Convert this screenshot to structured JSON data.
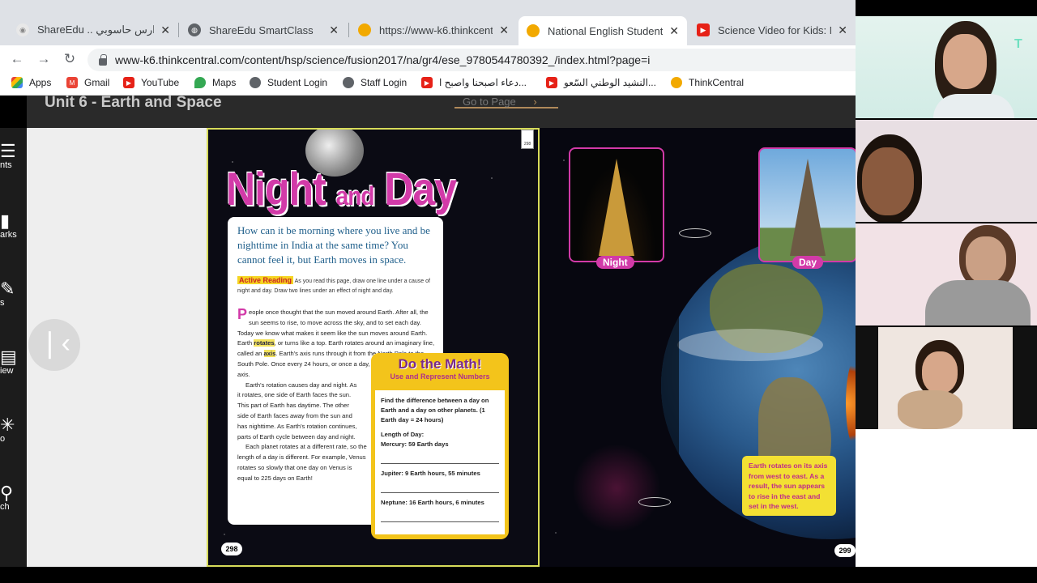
{
  "tabs": [
    {
      "title": "ShareEdu .. مدارس حاسوبي",
      "icon": "shareedu-icon",
      "active": false
    },
    {
      "title": "ShareEdu SmartClass",
      "icon": "globe-icon",
      "active": false
    },
    {
      "title": "https://www-k6.thinkcentra",
      "icon": "thinkcentral-icon",
      "active": false
    },
    {
      "title": "National English Student E",
      "icon": "thinkcentral-icon",
      "active": true
    },
    {
      "title": "Science Video for Kids: Nat",
      "icon": "youtube-icon",
      "active": false
    }
  ],
  "address_url": "www-k6.thinkcentral.com/content/hsp/science/fusion2017/na/gr4/ese_9780544780392_/index.html?page=i",
  "bookmarks": [
    {
      "label": "Apps"
    },
    {
      "label": "Gmail"
    },
    {
      "label": "YouTube"
    },
    {
      "label": "Maps"
    },
    {
      "label": "Student Login"
    },
    {
      "label": "Staff Login"
    },
    {
      "label": "دعاء اصبحنا واصبح ا..."
    },
    {
      "label": "النشيد الوطني السّعو..."
    },
    {
      "label": "ThinkCentral"
    }
  ],
  "viewer": {
    "unit_title": "Unit 6 - Earth and Space",
    "goto_label": "Go to Page",
    "left_nav": [
      "nts",
      "arks",
      "s",
      "iew",
      "o",
      "ch"
    ]
  },
  "left_page": {
    "title_night": "Night",
    "title_and": "and",
    "title_day": "Day",
    "question": "How can it be morning where you live and be nighttime in India at the same time? You cannot feel it, but Earth moves in space.",
    "active_reading_tag": "Active Reading",
    "active_reading_text": "As you read this page, draw one line under a cause of night and day. Draw two lines under an effect of night and day.",
    "drop_cap": "P",
    "p1_a": "eople once thought that the sun moved around Earth. After all, the sun seems to rise, to move across the sky, and to set each day. Today we know what makes it seem like the sun moves around Earth. Earth ",
    "rotates": "rotates",
    "p1_b": ", or turns like a top. Earth rotates around an imaginary line, called an ",
    "axis": "axis",
    "p1_c": ". Earth's axis runs through it from the North Pole to the South Pole. Once every 24 hours, or once a day, Earth rotates about its axis.",
    "p2": "Earth's rotation causes day and night. As it rotates, one side of Earth faces the sun. This part of Earth has daytime. The other side of Earth faces away from the sun and has nighttime. As Earth's rotation continues, parts of Earth cycle between day and night.",
    "p3": "Each planet rotates at a different rate, so the length of a day is different. For example, Venus rotates so slowly that one day on Venus is equal to 225 days on Earth!",
    "page_number": "298",
    "ribbon_number": "298",
    "math_title": "Do the Math!",
    "math_subtitle": "Use and Represent Numbers",
    "math_prompt": "Find the difference between a day on Earth and a day on other planets. (1 Earth day = 24 hours)",
    "math_len_label": "Length of Day:",
    "math_mercury": "Mercury: 59 Earth days",
    "math_jupiter": "Jupiter: 9 Earth hours, 55 minutes",
    "math_neptune": "Neptune: 16 Earth hours, 6 minutes"
  },
  "right_page": {
    "night_label": "Night",
    "day_label": "Day",
    "fact": "Earth rotates on its axis from west to east. As a result, the sun appears to rise in the east and set in the west.",
    "page_number": "299"
  },
  "colors": {
    "accent": "#d23aa8",
    "highlight": "#f3e35c",
    "math_yellow": "#f3c41b"
  }
}
